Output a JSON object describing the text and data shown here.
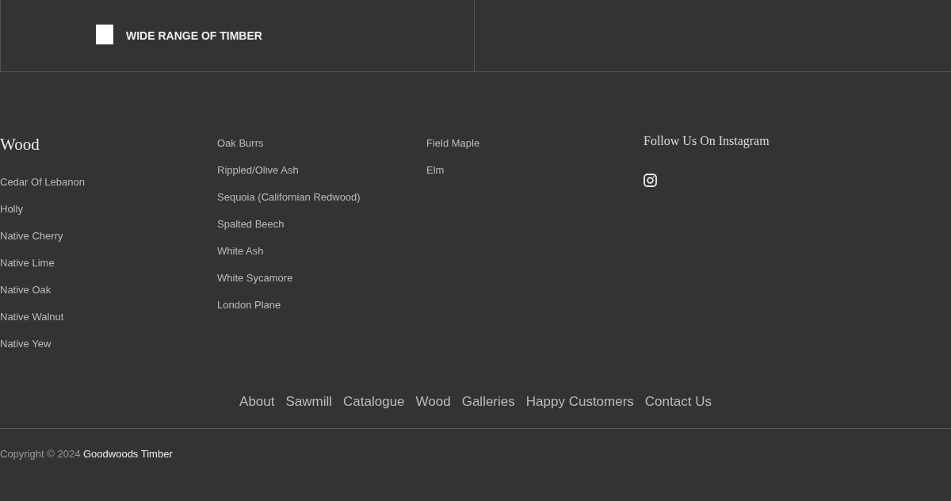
{
  "feature": {
    "label": "WIDE RANGE OF TIMBER"
  },
  "wood": {
    "heading": "Wood",
    "columns": [
      [
        "Cedar Of Lebanon",
        "Holly",
        "Native Cherry",
        "Native Lime",
        "Native Oak",
        "Native Walnut",
        "Native Yew"
      ],
      [
        "Oak Burrs",
        "Rippled/Olive Ash",
        "Sequoia (Californian Redwood)",
        "Spalted Beech",
        "White Ash",
        "White Sycamore",
        "London Plane"
      ],
      [
        "Field Maple",
        "Elm"
      ]
    ]
  },
  "instagram": {
    "heading": "Follow Us On Instagram"
  },
  "nav": [
    "About",
    "Sawmill",
    "Catalogue",
    "Wood",
    "Galleries",
    "Happy Customers",
    "Contact Us"
  ],
  "copyright": {
    "text": "Copyright © 2024",
    "brand": "Goodwoods Timber"
  }
}
